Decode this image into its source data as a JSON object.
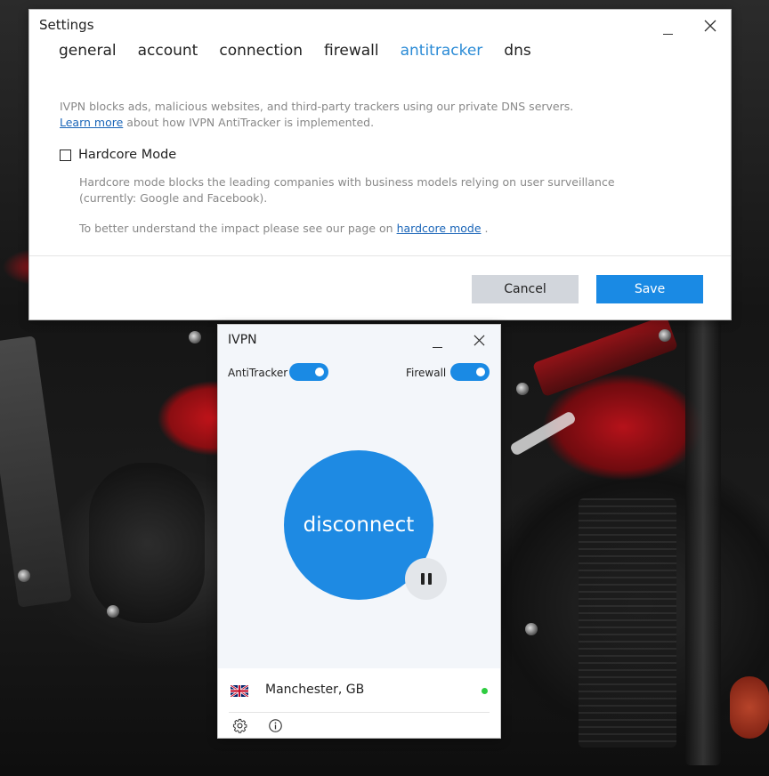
{
  "settings": {
    "title": "Settings",
    "tabs": [
      {
        "label": "general"
      },
      {
        "label": "account"
      },
      {
        "label": "connection"
      },
      {
        "label": "firewall"
      },
      {
        "label": "antitracker",
        "active": true
      },
      {
        "label": "dns"
      }
    ],
    "description_line1": "IVPN blocks ads, malicious websites, and third-party trackers using our private DNS servers.",
    "learn_more_link": "Learn more",
    "description_line2_suffix": " about how IVPN AntiTracker is implemented.",
    "hardcore_label": "Hardcore Mode",
    "hardcore_checked": false,
    "hardcore_desc_line1": "Hardcore mode blocks the leading companies with business models relying on user surveillance",
    "hardcore_desc_line2": "(currently: Google and Facebook).",
    "impact_prefix": "To better understand the impact please see our page on ",
    "impact_link": "hardcore mode",
    "impact_suffix": " .",
    "cancel_label": "Cancel",
    "save_label": "Save"
  },
  "ivpn": {
    "title": "IVPN",
    "antitracker_label": "AntiTracker",
    "antitracker_on": true,
    "firewall_label": "Firewall",
    "firewall_on": true,
    "connect_button_label": "disconnect",
    "location": "Manchester, GB",
    "flag_icon": "uk-flag-icon",
    "status_color": "#2ecc40"
  },
  "colors": {
    "accent": "#1a8ae4",
    "active_tab": "#2b8bd6",
    "link": "#1a65b8"
  }
}
